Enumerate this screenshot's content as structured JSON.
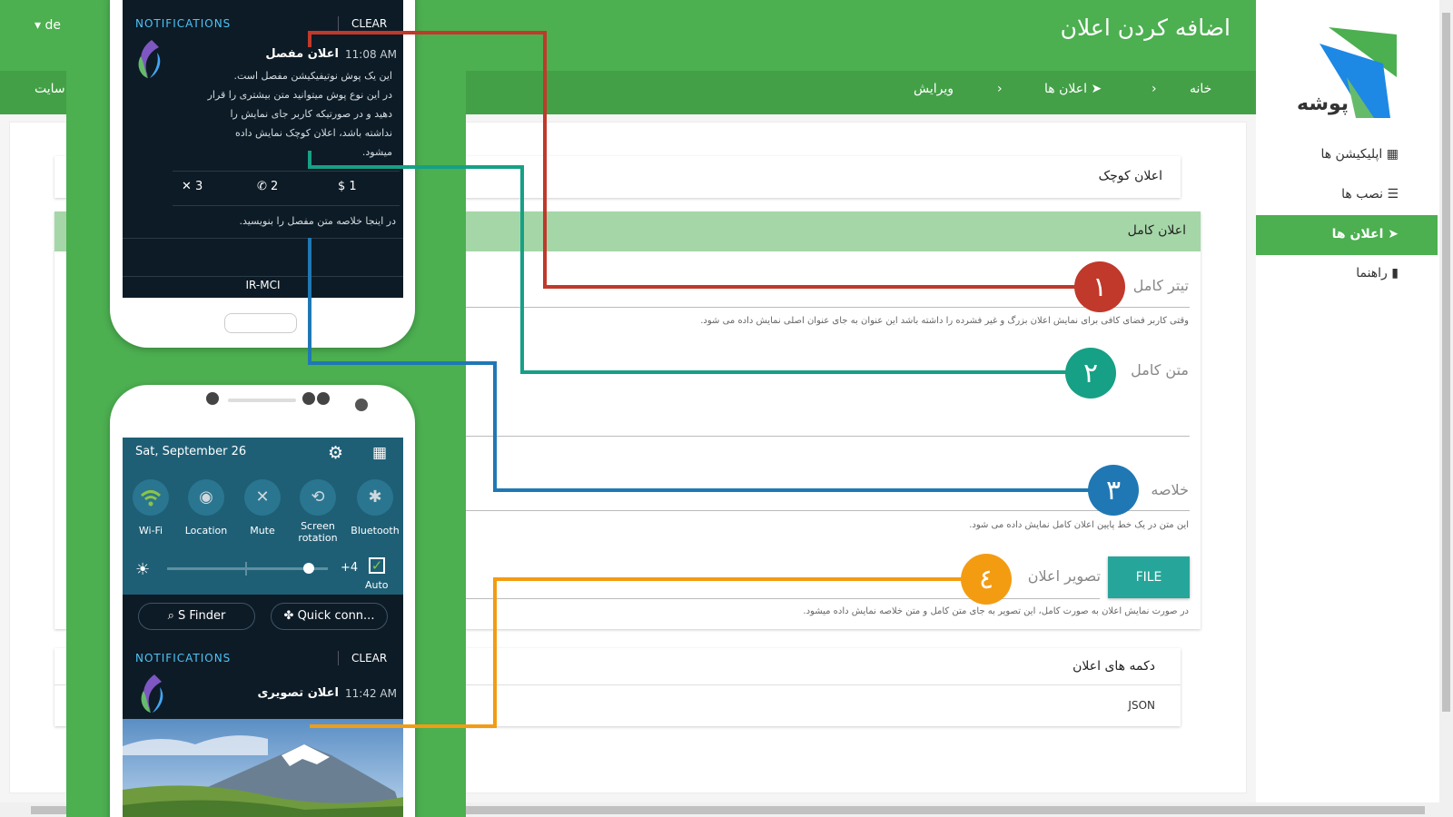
{
  "header": {
    "title": "اضافه کردن اعلان",
    "breadcrumb": [
      "خانه",
      "اعلان ها",
      "ویرایش"
    ],
    "lang": "de",
    "site_link": "سایت"
  },
  "sidebar": {
    "logo_text": "پوشه",
    "items": [
      {
        "label": "اپلیکیشن ها",
        "icon": "grid-icon",
        "active": false
      },
      {
        "label": "نصب ها",
        "icon": "list-icon",
        "active": false
      },
      {
        "label": "اعلان ها",
        "icon": "send-icon",
        "active": true
      },
      {
        "label": "راهنما",
        "icon": "book-icon",
        "active": false
      }
    ]
  },
  "form": {
    "small_notification": "اعلان کوچک",
    "full_notification": "اعلان کامل",
    "full_title_label": "تیتر کامل",
    "full_title_hint": "وقتی کاربر فضای کافی برای نمایش اعلان بزرگ و غیر فشرده را داشته باشد این عنوان به جای عنوان اصلی نمایش داده می شود.",
    "full_text_label": "متن کامل",
    "summary_label": "خلاصه",
    "summary_hint": "این متن در یک خط پایین اعلان کامل نمایش داده می شود.",
    "image_label": "تصویر اعلان",
    "file_button": "FILE",
    "image_hint": "در صورت نمایش اعلان به صورت کامل، این تصویر به جای متن کامل و متن خلاصه نمایش داده میشود.",
    "buttons_label": "دکمه های اعلان",
    "json_label": "JSON"
  },
  "callouts": {
    "one": "١",
    "two": "٢",
    "three": "٣",
    "four": "٤",
    "colors": {
      "one": "#c0392b",
      "two": "#16a085",
      "three": "#1f78b4",
      "four": "#f39c12"
    }
  },
  "phone1": {
    "notifications_label": "NOTIFICATIONS",
    "clear_label": "CLEAR",
    "title": "اعلان مفصل",
    "time": "11:08 AM",
    "body": [
      "این یک پوش نوتیفیکیشن مفصل است.",
      "در این نوع پوش میتوانید متن بیشتری را قرار",
      "دهید و در صورتیکه کاربر جای نمایش را",
      "نداشته باشد، اعلان کوچک نمایش داده",
      "میشود."
    ],
    "actions": [
      {
        "icon": "close-icon",
        "label": "3"
      },
      {
        "icon": "phone-icon",
        "label": "2"
      },
      {
        "icon": "dollar-icon",
        "label": "1"
      }
    ],
    "summary": "در اینجا خلاصه متن مفصل را بنویسید.",
    "carrier": "IR-MCI"
  },
  "phone2": {
    "date": "Sat, September 26",
    "toggles": [
      {
        "icon": "wifi-icon",
        "label": "Wi-Fi"
      },
      {
        "icon": "location-icon",
        "label": "Location"
      },
      {
        "icon": "mute-icon",
        "label": "Mute"
      },
      {
        "icon": "screen-rotation-icon",
        "label": "Screen rotation"
      },
      {
        "icon": "bluetooth-icon",
        "label": "Bluetooth"
      }
    ],
    "brightness_value": "+4",
    "brightness_level": 0.88,
    "auto_label": "Auto",
    "s_finder": "S Finder",
    "quick_connect": "Quick conn...",
    "notifications_label": "NOTIFICATIONS",
    "clear_label": "CLEAR",
    "image_title": "اعلان تصویری",
    "time": "11:42 AM"
  },
  "colors": {
    "green": "#4caf50",
    "green_light": "#a5d6a7",
    "teal_button": "#26a69a"
  }
}
